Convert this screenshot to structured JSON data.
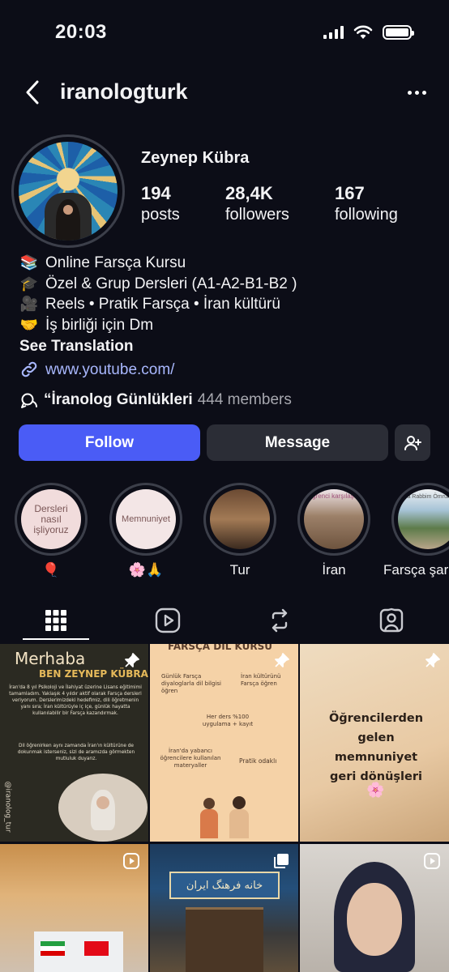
{
  "status": {
    "time": "20:03"
  },
  "nav": {
    "username": "iranologturk"
  },
  "profile": {
    "name": "Zeynep Kübra",
    "stats": [
      {
        "value": "194",
        "label": "posts"
      },
      {
        "value": "28,4K",
        "label": "followers"
      },
      {
        "value": "167",
        "label": "following"
      }
    ],
    "bio": [
      {
        "emoji": "📚",
        "text": "Online Farsça Kursu"
      },
      {
        "emoji": "🎓",
        "text": "Özel & Grup Dersleri (A1-A2-B1-B2 )"
      },
      {
        "emoji": "🎥",
        "text": "Reels • Pratik Farsça • İran kültürü"
      },
      {
        "emoji": "🤝",
        "text": "İş birliği için Dm"
      }
    ],
    "see_translation": "See Translation",
    "link": "www.youtube.com/",
    "channel": {
      "name": "“İranolog Günlükleri",
      "members": "444 members"
    }
  },
  "actions": {
    "follow": "Follow",
    "message": "Message"
  },
  "highlights": [
    {
      "cover": "Dersleri nasıl işliyoruz",
      "label": "🎈"
    },
    {
      "cover": "Memnuniyet",
      "label": "🌸🙏"
    },
    {
      "cover": "",
      "label": "Tur"
    },
    {
      "cover": "Öğrenci karşılaştık",
      "label": "İran"
    },
    {
      "cover": "Ya Rabbim Ömrüm",
      "label": "Farsça şar"
    }
  ],
  "posts": {
    "p1_title": "Merhaba",
    "p1_subtitle": "BEN ZEYNEP KÜBRA",
    "p1_body": "İran'da 8 yıl Psikoloji ve İlahiyat üzerine Lisans eğitimimi tamamladım. Yaklaşık 4 yıldır aktif olarak Farsça dersleri veriyorum. Derslerimizdeki hedefimiz, dili öğretmenin yanı sıra; İran kültürüyle iç içe, günlük hayatta kullanılabilir bir Farsça kazandırmak.",
    "p1_body2": "Dil öğrenirken aynı zamanda İran'ın kültürüne de dokunmak isterseniz, sizi de aramızda görmekten mutluluk duyarız.",
    "p1_handle": "@iranolog_tur",
    "p2_title": "FARSÇA DİL KURSU",
    "p2_items": [
      "Günlük Farsça diyaloglarla dil bilgisi öğren",
      "İran kültürünü Farsça öğren",
      "Her ders %100 uygulama + kayıt",
      "İran'da yabancı öğrencilere kullanılan materyaller",
      "Pratik odaklı"
    ],
    "p3_text": "Öğrencilerden gelen memnuniyet geri dönüşleri",
    "p5_sign": "خانه فرهنگ ایران"
  },
  "colors": {
    "accent": "#4a5cf6",
    "background": "#0c0d17",
    "button": "#2b2d36",
    "link": "#a9b8ff"
  }
}
